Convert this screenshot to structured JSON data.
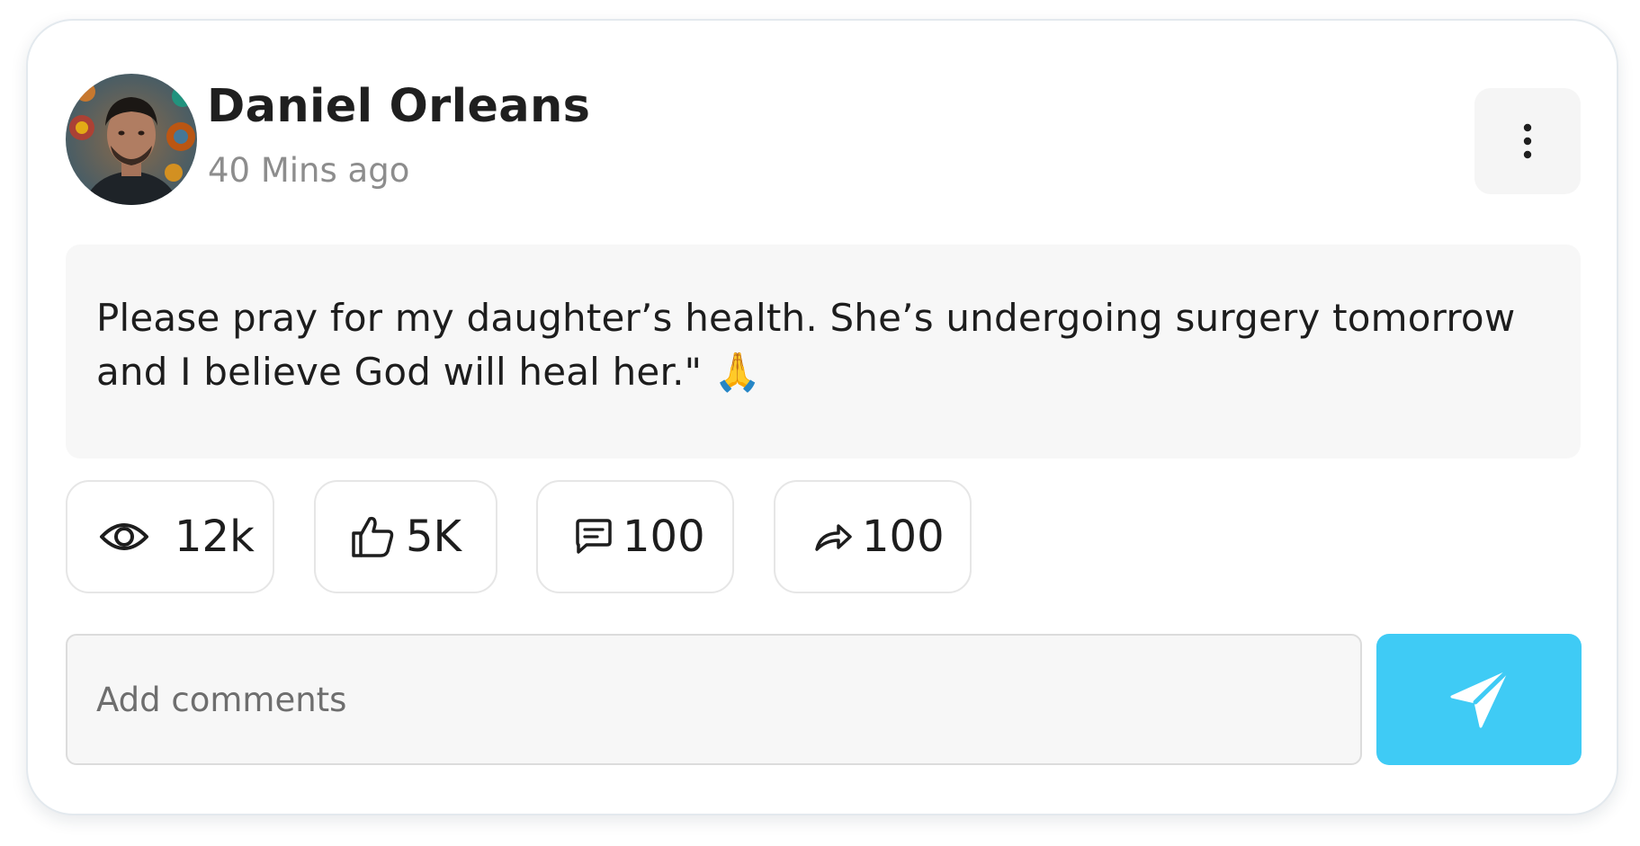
{
  "post": {
    "author_name": "Daniel Orleans",
    "time_ago": "40 Mins ago",
    "text": "Please pray for my daughter’s health. She’s undergoing surgery tomorrow and I believe God will heal her.\" 🙏"
  },
  "stats": {
    "views": "12k",
    "likes": "5K",
    "comments": "100",
    "shares": "100"
  },
  "comment_box": {
    "placeholder": "Add comments"
  },
  "icons": {
    "more": "more-vertical-icon",
    "views": "eye-icon",
    "likes": "thumbs-up-icon",
    "comments": "comment-icon",
    "shares": "share-arrow-icon",
    "send": "send-icon"
  },
  "colors": {
    "accent": "#3fcbf5",
    "card_border": "#e3e9ee",
    "panel_bg": "#f7f7f7",
    "muted_text": "#8d8d8d"
  }
}
